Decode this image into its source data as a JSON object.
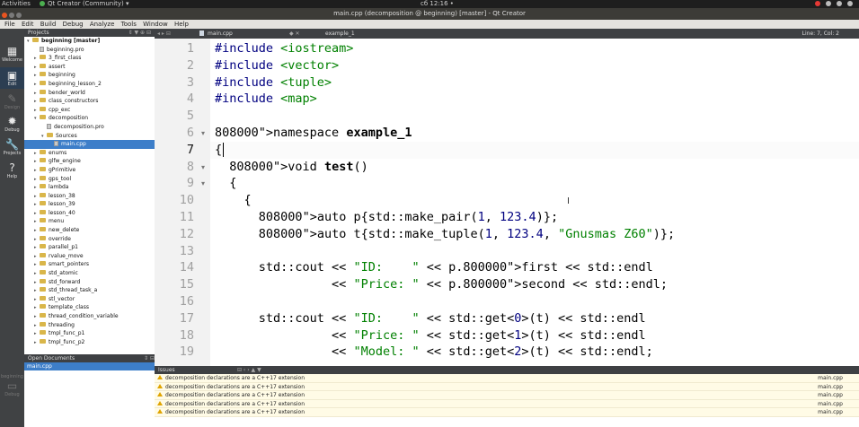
{
  "system_bar": {
    "activities": "Activities",
    "app_name": "Qt Creator (Community) ▾",
    "clock": "сб 12:16 •"
  },
  "window": {
    "title": "main.cpp (decomposition @ beginning) [master] - Qt Creator"
  },
  "menu": [
    "File",
    "Edit",
    "Build",
    "Debug",
    "Analyze",
    "Tools",
    "Window",
    "Help"
  ],
  "modes": [
    {
      "label": "Welcome",
      "icon": "grid-icon",
      "glyph": "▦"
    },
    {
      "label": "Edit",
      "icon": "edit-icon",
      "glyph": "▣"
    },
    {
      "label": "Design",
      "icon": "design-icon",
      "glyph": "✎"
    },
    {
      "label": "Debug",
      "icon": "debug-icon",
      "glyph": "✹"
    },
    {
      "label": "Projects",
      "icon": "wrench-icon",
      "glyph": "🔧"
    },
    {
      "label": "Help",
      "icon": "help-icon",
      "glyph": "?"
    },
    {
      "label": "beginning",
      "icon": "monitor-icon",
      "glyph": "▭"
    },
    {
      "label": "Debug",
      "icon": "build-config-icon",
      "glyph": ""
    }
  ],
  "projects_pane": {
    "title": "Projects",
    "tree": [
      {
        "label": "beginning [master]",
        "level": 0,
        "type": "project",
        "arrow": "▾"
      },
      {
        "label": "beginning.pro",
        "level": 1,
        "type": "file",
        "arrow": ""
      },
      {
        "label": "3_first_class",
        "level": 1,
        "type": "folder",
        "arrow": "▸"
      },
      {
        "label": "assert",
        "level": 1,
        "type": "folder",
        "arrow": "▸"
      },
      {
        "label": "beginning",
        "level": 1,
        "type": "folder",
        "arrow": "▸"
      },
      {
        "label": "beginning_lesson_2",
        "level": 1,
        "type": "folder",
        "arrow": "▸"
      },
      {
        "label": "bender_world",
        "level": 1,
        "type": "folder",
        "arrow": "▸"
      },
      {
        "label": "class_constructors",
        "level": 1,
        "type": "folder",
        "arrow": "▸"
      },
      {
        "label": "cpp_exc",
        "level": 1,
        "type": "folder",
        "arrow": "▸"
      },
      {
        "label": "decomposition",
        "level": 1,
        "type": "folder",
        "arrow": "▾"
      },
      {
        "label": "decomposition.pro",
        "level": 2,
        "type": "file",
        "arrow": ""
      },
      {
        "label": "Sources",
        "level": 2,
        "type": "folder",
        "arrow": "▾"
      },
      {
        "label": "main.cpp",
        "level": 3,
        "type": "file",
        "arrow": "",
        "selected": true
      },
      {
        "label": "enums",
        "level": 1,
        "type": "folder",
        "arrow": "▸"
      },
      {
        "label": "glfw_engine",
        "level": 1,
        "type": "folder",
        "arrow": "▸"
      },
      {
        "label": "gPrimitive",
        "level": 1,
        "type": "folder",
        "arrow": "▸"
      },
      {
        "label": "gps_tool",
        "level": 1,
        "type": "folder",
        "arrow": "▸"
      },
      {
        "label": "lambda",
        "level": 1,
        "type": "folder",
        "arrow": "▸"
      },
      {
        "label": "lesson_38",
        "level": 1,
        "type": "folder",
        "arrow": "▸"
      },
      {
        "label": "lesson_39",
        "level": 1,
        "type": "folder",
        "arrow": "▸"
      },
      {
        "label": "lesson_40",
        "level": 1,
        "type": "folder",
        "arrow": "▸"
      },
      {
        "label": "menu",
        "level": 1,
        "type": "folder",
        "arrow": "▸"
      },
      {
        "label": "new_delete",
        "level": 1,
        "type": "folder",
        "arrow": "▸"
      },
      {
        "label": "override",
        "level": 1,
        "type": "folder",
        "arrow": "▸"
      },
      {
        "label": "parallel_p1",
        "level": 1,
        "type": "folder",
        "arrow": "▸"
      },
      {
        "label": "rvalue_move",
        "level": 1,
        "type": "folder",
        "arrow": "▸"
      },
      {
        "label": "smart_pointers",
        "level": 1,
        "type": "folder",
        "arrow": "▸"
      },
      {
        "label": "std_atomic",
        "level": 1,
        "type": "folder",
        "arrow": "▸"
      },
      {
        "label": "std_forward",
        "level": 1,
        "type": "folder",
        "arrow": "▸"
      },
      {
        "label": "std_thread_task_a",
        "level": 1,
        "type": "folder",
        "arrow": "▸"
      },
      {
        "label": "stl_vector",
        "level": 1,
        "type": "folder",
        "arrow": "▸"
      },
      {
        "label": "template_class",
        "level": 1,
        "type": "folder",
        "arrow": "▸"
      },
      {
        "label": "thread_condition_variable",
        "level": 1,
        "type": "folder",
        "arrow": "▸"
      },
      {
        "label": "threading",
        "level": 1,
        "type": "folder",
        "arrow": "▸"
      },
      {
        "label": "tmpl_func_p1",
        "level": 1,
        "type": "folder",
        "arrow": "▸"
      },
      {
        "label": "tmpl_func_p2",
        "level": 1,
        "type": "folder",
        "arrow": "▸"
      }
    ]
  },
  "open_documents": {
    "title": "Open Documents",
    "items": [
      "main.cpp"
    ]
  },
  "editor": {
    "file_tab": "main.cpp",
    "symbol": "example_1",
    "position": "Line: 7, Col: 2",
    "current_line": 7,
    "lines": [
      {
        "n": "1",
        "text": "#include <iostream>",
        "fold": ""
      },
      {
        "n": "2",
        "text": "#include <vector>",
        "fold": ""
      },
      {
        "n": "3",
        "text": "#include <tuple>",
        "fold": ""
      },
      {
        "n": "4",
        "text": "#include <map>",
        "fold": ""
      },
      {
        "n": "5",
        "text": "",
        "fold": ""
      },
      {
        "n": "6",
        "text": "namespace example_1",
        "fold": "▾"
      },
      {
        "n": "7",
        "text": "{",
        "fold": ""
      },
      {
        "n": "8",
        "text": "  void test()",
        "fold": "▾"
      },
      {
        "n": "9",
        "text": "  {",
        "fold": "▾"
      },
      {
        "n": "10",
        "text": "    {",
        "fold": ""
      },
      {
        "n": "11",
        "text": "      auto p{std::make_pair(1, 123.4)};",
        "fold": ""
      },
      {
        "n": "12",
        "text": "      auto t{std::make_tuple(1, 123.4, \"Gnusmas Z60\")};",
        "fold": ""
      },
      {
        "n": "13",
        "text": "",
        "fold": ""
      },
      {
        "n": "14",
        "text": "      std::cout << \"ID:    \" << p.first << std::endl",
        "fold": ""
      },
      {
        "n": "15",
        "text": "                << \"Price: \" << p.second << std::endl;",
        "fold": ""
      },
      {
        "n": "16",
        "text": "",
        "fold": ""
      },
      {
        "n": "17",
        "text": "      std::cout << \"ID:    \" << std::get<0>(t) << std::endl",
        "fold": ""
      },
      {
        "n": "18",
        "text": "                << \"Price: \" << std::get<1>(t) << std::endl",
        "fold": ""
      },
      {
        "n": "19",
        "text": "                << \"Model: \" << std::get<2>(t) << std::endl;",
        "fold": ""
      }
    ],
    "colors": {
      "preprocessor": "#000080",
      "include_target": "#008000",
      "keyword": "#808000",
      "string": "#008000",
      "identifier": "#000000",
      "field": "#800000",
      "number": "#000080"
    }
  },
  "issues_pane": {
    "title": "Issues",
    "items": [
      {
        "text": "decomposition declarations are a C++17 extension",
        "file": "main.cpp"
      },
      {
        "text": "decomposition declarations are a C++17 extension",
        "file": "main.cpp"
      },
      {
        "text": "decomposition declarations are a C++17 extension",
        "file": "main.cpp"
      },
      {
        "text": "decomposition declarations are a C++17 extension",
        "file": "main.cpp"
      },
      {
        "text": "decomposition declarations are a C++17 extension",
        "file": "main.cpp"
      }
    ]
  }
}
